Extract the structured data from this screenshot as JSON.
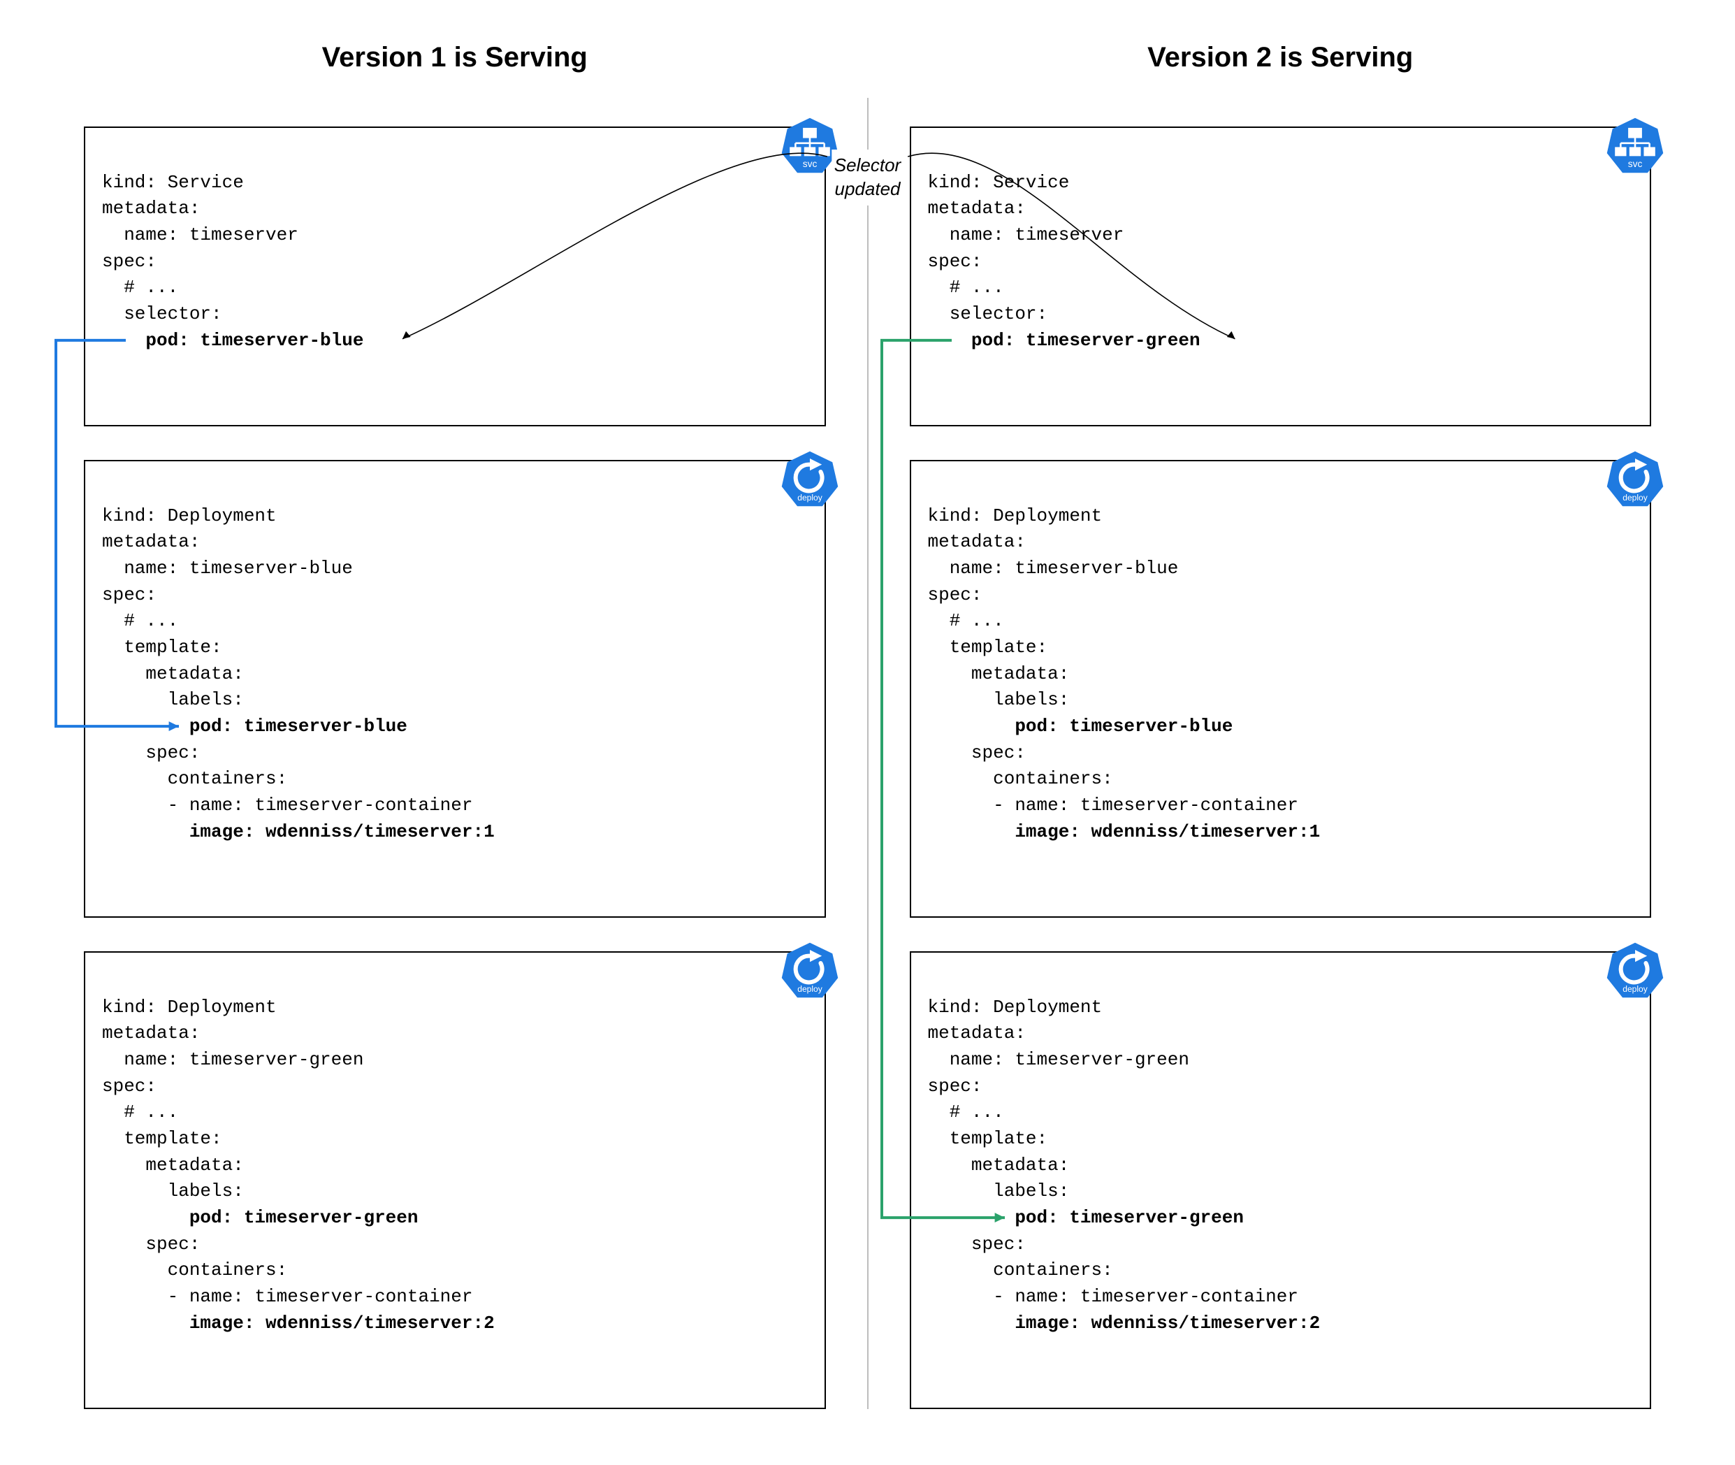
{
  "center_label_line1": "Selector",
  "center_label_line2": "updated",
  "icons": {
    "svc": "svc",
    "deploy": "deploy"
  },
  "colors": {
    "icon_fill": "#1f7ae0",
    "arrow_blue": "#1f7ae0",
    "arrow_green": "#2ba26b",
    "arrow_black": "#000000"
  },
  "left": {
    "title": "Version 1 is Serving",
    "service": {
      "l1": "kind: Service",
      "l2": "metadata:",
      "l3": "  name: timeserver",
      "l4": "spec:",
      "l5": "  # ...",
      "l6": "  selector:",
      "l7": "    pod: timeserver-blue"
    },
    "deploy_blue": {
      "l1": "kind: Deployment",
      "l2": "metadata:",
      "l3": "  name: timeserver-blue",
      "l4": "spec:",
      "l5": "  # ...",
      "l6": "  template:",
      "l7": "    metadata:",
      "l8": "      labels:",
      "l9": "        pod: timeserver-blue",
      "l10": "    spec:",
      "l11": "      containers:",
      "l12": "      - name: timeserver-container",
      "l13": "        image: wdenniss/timeserver:1"
    },
    "deploy_green": {
      "l1": "kind: Deployment",
      "l2": "metadata:",
      "l3": "  name: timeserver-green",
      "l4": "spec:",
      "l5": "  # ...",
      "l6": "  template:",
      "l7": "    metadata:",
      "l8": "      labels:",
      "l9": "        pod: timeserver-green",
      "l10": "    spec:",
      "l11": "      containers:",
      "l12": "      - name: timeserver-container",
      "l13": "        image: wdenniss/timeserver:2"
    }
  },
  "right": {
    "title": "Version 2 is Serving",
    "service": {
      "l1": "kind: Service",
      "l2": "metadata:",
      "l3": "  name: timeserver",
      "l4": "spec:",
      "l5": "  # ...",
      "l6": "  selector:",
      "l7": "    pod: timeserver-green"
    },
    "deploy_blue": {
      "l1": "kind: Deployment",
      "l2": "metadata:",
      "l3": "  name: timeserver-blue",
      "l4": "spec:",
      "l5": "  # ...",
      "l6": "  template:",
      "l7": "    metadata:",
      "l8": "      labels:",
      "l9": "        pod: timeserver-blue",
      "l10": "    spec:",
      "l11": "      containers:",
      "l12": "      - name: timeserver-container",
      "l13": "        image: wdenniss/timeserver:1"
    },
    "deploy_green": {
      "l1": "kind: Deployment",
      "l2": "metadata:",
      "l3": "  name: timeserver-green",
      "l4": "spec:",
      "l5": "  # ...",
      "l6": "  template:",
      "l7": "    metadata:",
      "l8": "      labels:",
      "l9": "        pod: timeserver-green",
      "l10": "    spec:",
      "l11": "      containers:",
      "l12": "      - name: timeserver-container",
      "l13": "        image: wdenniss/timeserver:2"
    }
  }
}
